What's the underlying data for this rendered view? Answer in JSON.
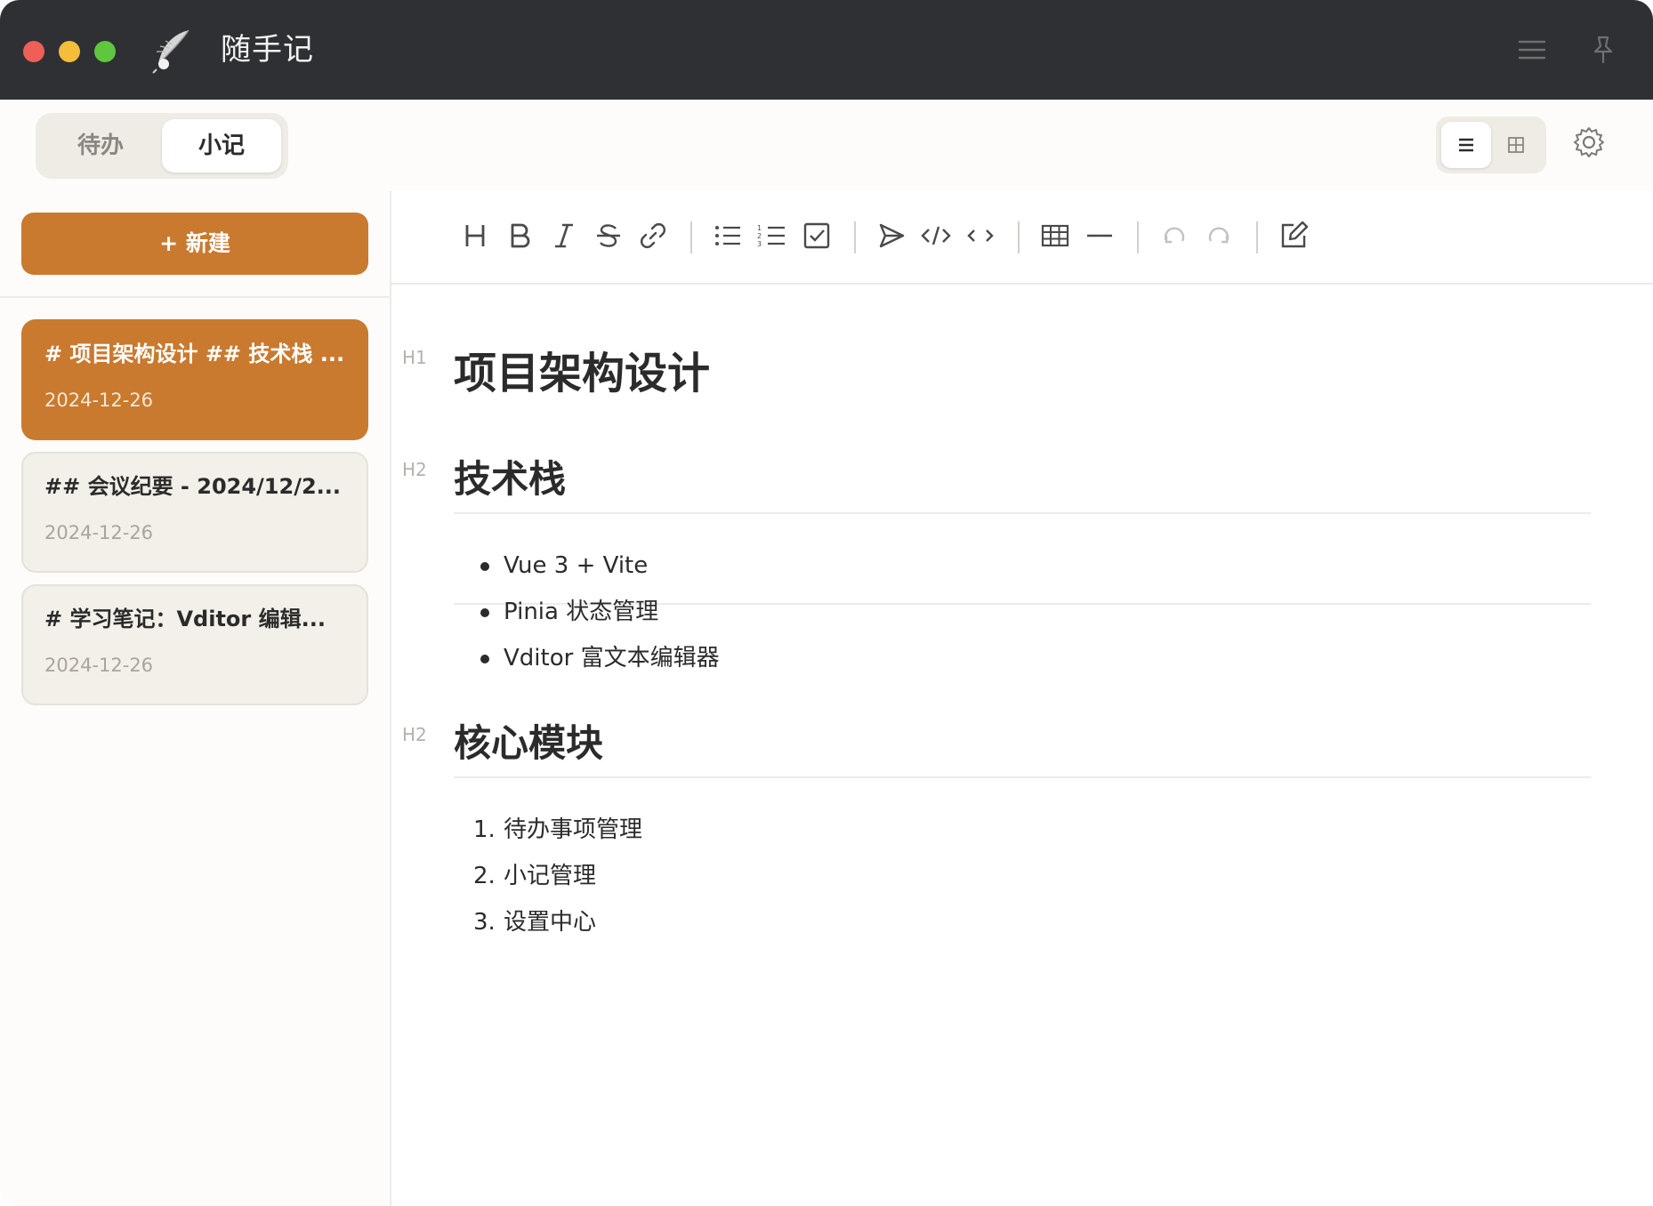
{
  "window": {
    "app_title": "随手记"
  },
  "tabs": [
    {
      "label": "待办",
      "active": false
    },
    {
      "label": "小记",
      "active": true
    }
  ],
  "sidebar": {
    "new_button": "+ 新建",
    "notes": [
      {
        "title": "# 项目架构设计 ## 技术栈 ...",
        "date": "2024-12-26",
        "active": true
      },
      {
        "title": "## 会议纪要 - 2024/12/2...",
        "date": "2024-12-26",
        "active": false
      },
      {
        "title": "# 学习笔记：Vditor 编辑...",
        "date": "2024-12-26",
        "active": false
      }
    ]
  },
  "toolbar": {
    "tools": [
      "heading-icon",
      "bold-icon",
      "italic-icon",
      "strikethrough-icon",
      "link-icon",
      "bullet-list-icon",
      "ordered-list-icon",
      "checklist-icon",
      "quote-icon",
      "code-block-icon",
      "inline-code-icon",
      "table-icon",
      "horizontal-rule-icon",
      "undo-icon",
      "redo-icon",
      "edit-mode-icon"
    ]
  },
  "editor": {
    "hints": {
      "h1": "H1",
      "h2": "H2"
    },
    "h1": "项目架构设计",
    "section1": {
      "heading": "技术栈",
      "items": [
        "Vue 3 + Vite",
        "Pinia 状态管理",
        "Vditor 富文本编辑器"
      ]
    },
    "section2": {
      "heading": "核心模块",
      "items": [
        {
          "num": "1.",
          "text": "待办事项管理"
        },
        {
          "num": "2.",
          "text": "小记管理"
        },
        {
          "num": "3.",
          "text": "设置中心"
        }
      ]
    }
  },
  "colors": {
    "accent": "#c97a2f",
    "titlebar": "#2f3033",
    "card_inactive": "#f3f0e9"
  }
}
